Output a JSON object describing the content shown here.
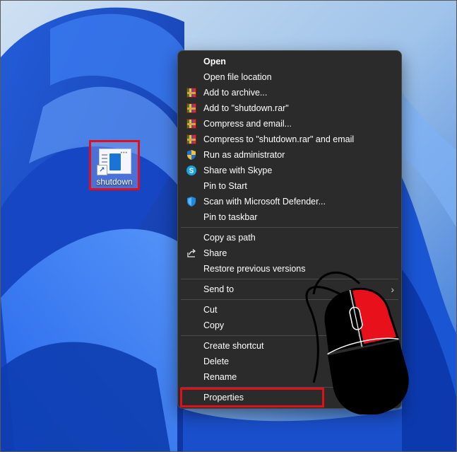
{
  "desktop": {
    "icon": {
      "label": "shutdown",
      "icon_name": "shortcut-file-icon"
    },
    "highlight_color": "#e0101a"
  },
  "context_menu": {
    "groups": [
      [
        {
          "label": "Open",
          "bold": true,
          "icon": null
        },
        {
          "label": "Open file location",
          "icon": null
        },
        {
          "label": "Add to archive...",
          "icon": "winrar-icon"
        },
        {
          "label": "Add to \"shutdown.rar\"",
          "icon": "winrar-icon"
        },
        {
          "label": "Compress and email...",
          "icon": "winrar-icon"
        },
        {
          "label": "Compress to \"shutdown.rar\" and email",
          "icon": "winrar-icon"
        },
        {
          "label": "Run as administrator",
          "icon": "uac-shield-icon"
        },
        {
          "label": "Share with Skype",
          "icon": "skype-icon"
        },
        {
          "label": "Pin to Start",
          "icon": null
        },
        {
          "label": "Scan with Microsoft Defender...",
          "icon": "defender-shield-icon"
        },
        {
          "label": "Pin to taskbar",
          "icon": null
        }
      ],
      [
        {
          "label": "Copy as path",
          "icon": null
        },
        {
          "label": "Share",
          "icon": "share-icon"
        },
        {
          "label": "Restore previous versions",
          "icon": null
        }
      ],
      [
        {
          "label": "Send to",
          "icon": null,
          "submenu": true
        }
      ],
      [
        {
          "label": "Cut",
          "icon": null
        },
        {
          "label": "Copy",
          "icon": null
        }
      ],
      [
        {
          "label": "Create shortcut",
          "icon": null
        },
        {
          "label": "Delete",
          "icon": null
        },
        {
          "label": "Rename",
          "icon": null
        }
      ],
      [
        {
          "label": "Properties",
          "icon": null,
          "highlighted": true
        }
      ]
    ]
  },
  "overlay": {
    "icon_name": "mouse-right-click-icon",
    "accent": "#e8101a"
  }
}
